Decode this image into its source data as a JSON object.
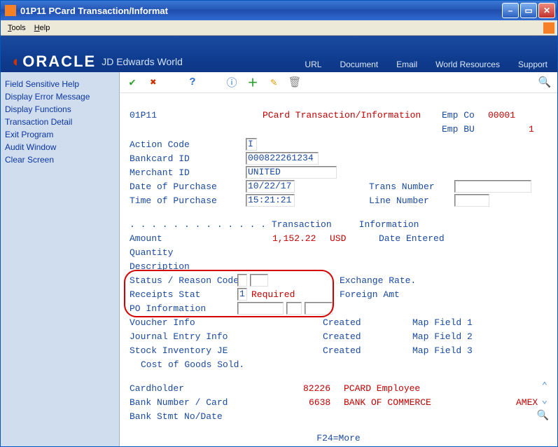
{
  "window": {
    "title": "01P11   PCard Transaction/Informat"
  },
  "menu": {
    "tools": "Tools",
    "help": "Help"
  },
  "banner": {
    "brand": "ORACLE",
    "product": "JD Edwards World",
    "links": [
      "URL",
      "Document",
      "Email",
      "World Resources",
      "Support"
    ]
  },
  "sidebar": {
    "items": [
      "Field Sensitive Help",
      "Display Error Message",
      "Display Functions",
      "Transaction Detail",
      "Exit Program",
      "Audit Window",
      "Clear Screen"
    ]
  },
  "screen": {
    "program": "01P11",
    "title": "PCard Transaction/Information",
    "emp_co_label": "Emp Co",
    "emp_co_value": "00001",
    "emp_bu_label": "Emp BU",
    "emp_bu_value": "1",
    "action_code_label": "Action Code",
    "action_code_value": "I",
    "bankcard_id_label": "Bankcard ID",
    "bankcard_id_value": "000822261234",
    "merchant_id_label": "Merchant ID",
    "merchant_id_value": "UNITED",
    "date_purchase_label": "Date of Purchase",
    "date_purchase_value": "10/22/17",
    "trans_number_label": "Trans Number",
    "time_purchase_label": "Time of Purchase",
    "time_purchase_value": "15:21:21",
    "line_number_label": "Line Number",
    "section_header": ". . . . . . . . . . . . . Transaction     Information",
    "amount_label": "Amount",
    "amount_value": "1,152.22",
    "currency": "USD",
    "date_entered_label": "Date Entered",
    "quantity_label": "Quantity",
    "description_label": "Description",
    "status_reason_label": "Status / Reason Code",
    "exchange_rate_label": "Exchange Rate.",
    "receipts_stat_label": "Receipts Stat",
    "receipts_stat_value": "1",
    "receipts_stat_text": "Required",
    "foreign_amt_label": "Foreign Amt",
    "po_info_label": "PO Information",
    "voucher_info_label": "Voucher Info",
    "created1": "Created",
    "map1_label": "Map Field 1",
    "journal_entry_label": "Journal Entry Info",
    "created2": "Created",
    "map2_label": "Map Field 2",
    "stock_inv_label": "Stock Inventory JE",
    "created3": "Created",
    "map3_label": "Map Field 3",
    "cogs_label": "Cost of Goods Sold.",
    "cardholder_label": "Cardholder",
    "cardholder_num": "82226",
    "cardholder_name": "PCARD Employee",
    "bank_label": "Bank Number / Card",
    "bank_num": "6638",
    "bank_name": "BANK OF COMMERCE",
    "bank_card_type": "AMEX",
    "bank_stmt_label": "Bank Stmt No/Date",
    "footer": "F24=More"
  }
}
